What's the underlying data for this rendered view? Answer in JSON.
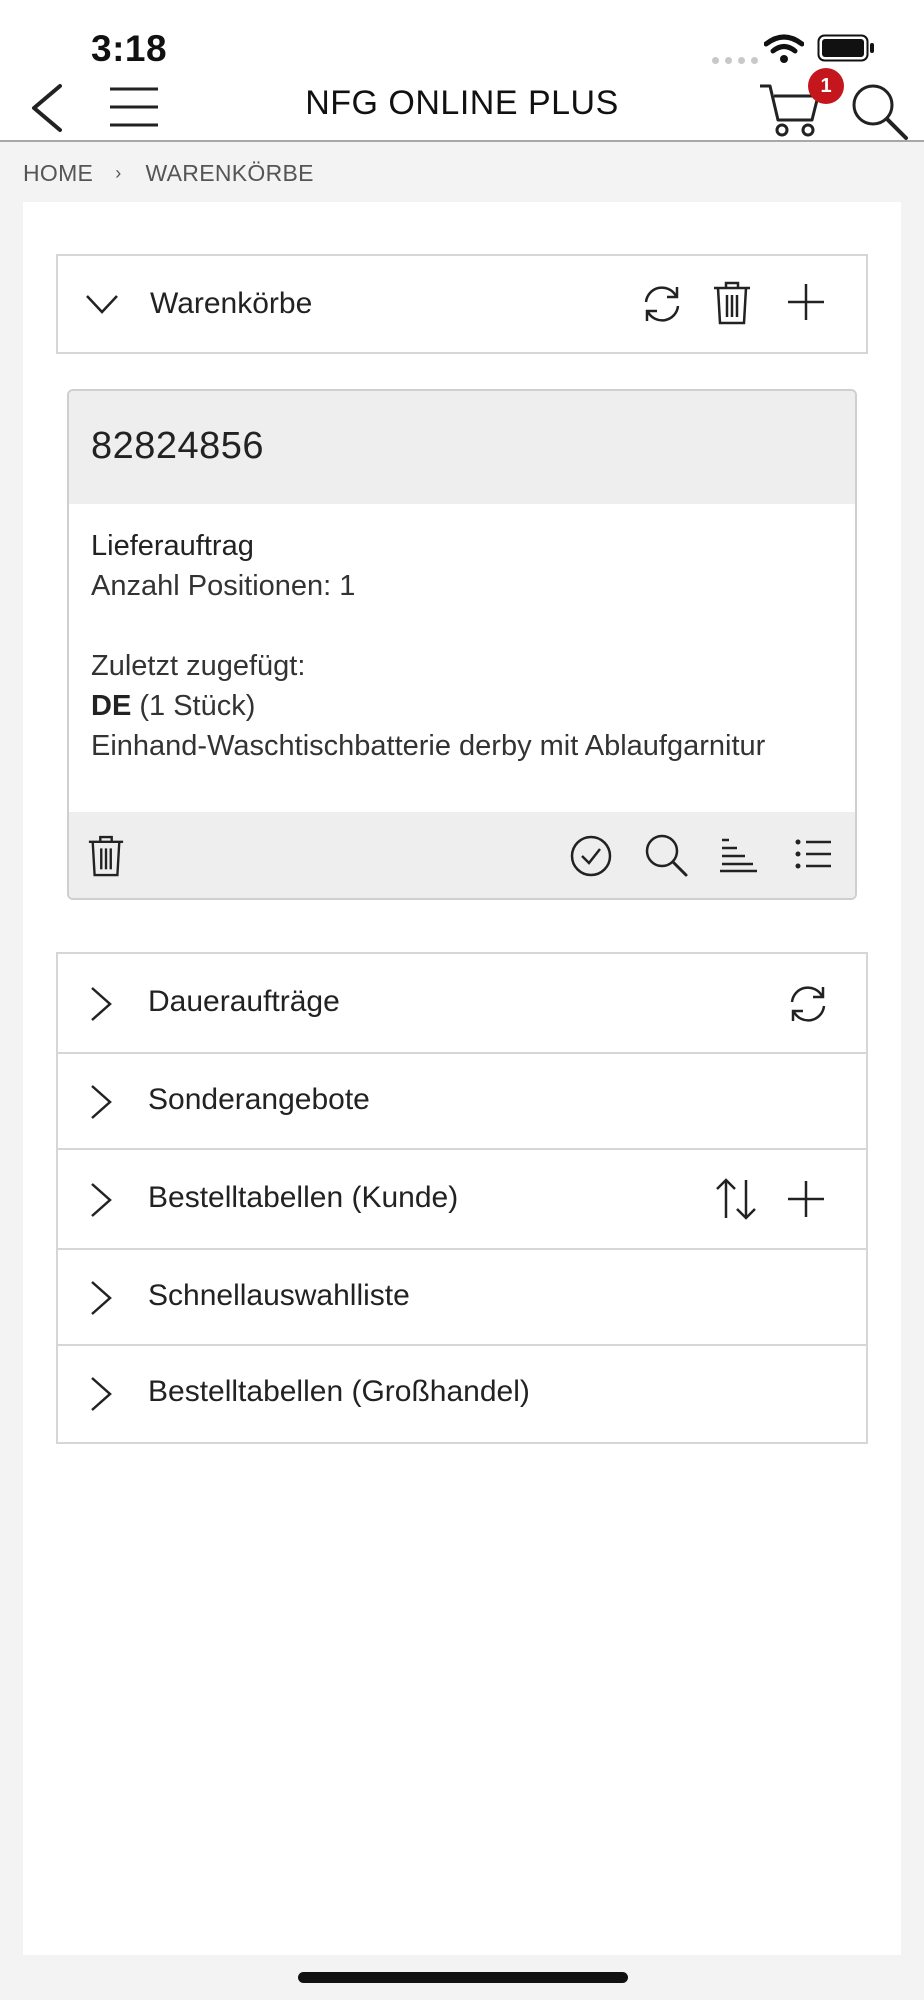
{
  "status_bar": {
    "time": "3:18"
  },
  "nav": {
    "title": "NFG ONLINE PLUS",
    "cart_badge": "1"
  },
  "breadcrumb": {
    "items": [
      "HOME",
      "WARENKÖRBE"
    ]
  },
  "carts_panel": {
    "title": "Warenkörbe",
    "card": {
      "number": "82824856",
      "type": "Lieferauftrag",
      "positions": "Anzahl Positionen: 1",
      "last_added_label": "Zuletzt zugefügt:",
      "last_added_brand": "DE",
      "last_added_qty": " (1 Stück)",
      "last_added_product": "Einhand-Waschtischbatterie derby mit Ablaufgarnitur"
    }
  },
  "sections": [
    {
      "label": "Daueraufträge"
    },
    {
      "label": "Sonderangebote"
    },
    {
      "label": "Bestelltabellen (Kunde)"
    },
    {
      "label": "Schnellauswahlliste"
    },
    {
      "label": "Bestelltabellen (Großhandel)"
    }
  ],
  "colors": {
    "badge": "#c4161c",
    "page_bg": "#f3f3f3",
    "card_head": "#eeeeee"
  }
}
